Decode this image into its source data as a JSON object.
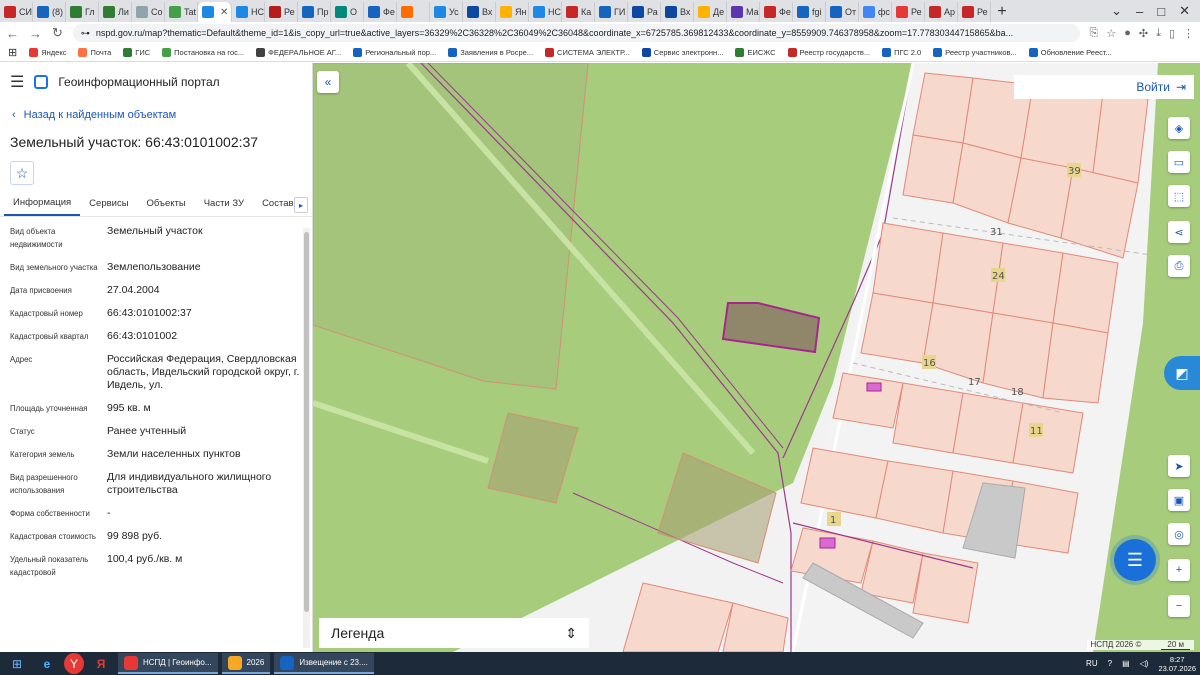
{
  "browser": {
    "tabs": [
      {
        "label": "СИ",
        "color": "#c62828"
      },
      {
        "label": "(8)",
        "color": "#1565c0"
      },
      {
        "label": "Гл",
        "color": "#2e7d32"
      },
      {
        "label": "Ли",
        "color": "#2e7d32"
      },
      {
        "label": "Со",
        "color": "#90a4ae"
      },
      {
        "label": "Tat",
        "color": "#43a047"
      },
      {
        "label": "",
        "color": "#1e88e5",
        "active": true
      },
      {
        "label": "НС",
        "color": "#1e88e5"
      },
      {
        "label": "Ре",
        "color": "#b71c1c"
      },
      {
        "label": "Пр",
        "color": "#1565c0"
      },
      {
        "label": "О",
        "color": "#00897b"
      },
      {
        "label": "Фе",
        "color": "#1565c0"
      },
      {
        "label": "",
        "color": "#ff6d00"
      },
      {
        "label": "Ус",
        "color": "#1e88e5"
      },
      {
        "label": "Вх",
        "color": "#0d47a1"
      },
      {
        "label": "Ян",
        "color": "#ffb300"
      },
      {
        "label": "НС",
        "color": "#1e88e5"
      },
      {
        "label": "Ка",
        "color": "#c62828"
      },
      {
        "label": "ГИ",
        "color": "#1565c0"
      },
      {
        "label": "Ра",
        "color": "#0d47a1"
      },
      {
        "label": "Вх",
        "color": "#0d47a1"
      },
      {
        "label": "Де",
        "color": "#ffb300"
      },
      {
        "label": "Ма",
        "color": "#5e35b1"
      },
      {
        "label": "Фе",
        "color": "#c62828"
      },
      {
        "label": "fgi",
        "color": "#1565c0"
      },
      {
        "label": "От",
        "color": "#1565c0"
      },
      {
        "label": "фс",
        "color": "#4285f4"
      },
      {
        "label": "Ре",
        "color": "#e53935"
      },
      {
        "label": "Ар",
        "color": "#c62828"
      },
      {
        "label": "Ре",
        "color": "#c62828"
      }
    ],
    "url": "nspd.gov.ru/map?thematic=Default&theme_id=1&is_copy_url=true&active_layers=36329%2C36328%2C36049%2C36048&coordinate_x=6725785.369812433&coordinate_y=8559909.746378958&zoom=17.77830344715865&ba...",
    "bookmarks": [
      {
        "label": "Яндекс",
        "color": "#e53935"
      },
      {
        "label": "Почта",
        "color": "#ff7043"
      },
      {
        "label": "ГИС",
        "color": "#2e7d32"
      },
      {
        "label": "Постановка на гос...",
        "color": "#43a047"
      },
      {
        "label": "ФЕДЕРАЛЬНОЕ АГ...",
        "color": "#424242"
      },
      {
        "label": "Региональный пор...",
        "color": "#1565c0"
      },
      {
        "label": "Заявления в Росре...",
        "color": "#1565c0"
      },
      {
        "label": "СИСТЕМА ЭЛЕКТР...",
        "color": "#c62828"
      },
      {
        "label": "Сервис электронн...",
        "color": "#0d47a1"
      },
      {
        "label": "ЕИСЖС",
        "color": "#2e7d32"
      },
      {
        "label": "Реестр государств...",
        "color": "#c62828"
      },
      {
        "label": "ПГС 2.0",
        "color": "#1565c0"
      },
      {
        "label": "Реестр участников...",
        "color": "#1565c0"
      },
      {
        "label": "Обновление Реест...",
        "color": "#1565c0"
      }
    ]
  },
  "portal": {
    "title": "Геоинформационный портал",
    "back_label": "Назад к найденным объектам",
    "object_title": "Земельный участок: 66:43:0101002:37",
    "tabs": [
      "Информация",
      "Сервисы",
      "Объекты",
      "Части ЗУ",
      "Состав"
    ],
    "props": [
      {
        "label": "Вид объекта недвижимости",
        "value": "Земельный участок"
      },
      {
        "label": "Вид земельного участка",
        "value": "Землепользование"
      },
      {
        "label": "Дата присвоения",
        "value": "27.04.2004"
      },
      {
        "label": "Кадастровый номер",
        "value": "66:43:0101002:37"
      },
      {
        "label": "Кадастровый квартал",
        "value": "66:43:0101002"
      },
      {
        "label": "Адрес",
        "value": "Российская Федерация, Свердловская область, Ивдельский городской округ, г. Ивдель, ул."
      },
      {
        "label": "Площадь уточненная",
        "value": "995 кв. м"
      },
      {
        "label": "Статус",
        "value": "Ранее учтенный"
      },
      {
        "label": "Категория земель",
        "value": "Земли населенных пунктов"
      },
      {
        "label": "Вид разрешенного использования",
        "value": "Для индивидуального жилищного строительства"
      },
      {
        "label": "Форма собственности",
        "value": "-"
      },
      {
        "label": "Кадастровая стоимость",
        "value": "99 898 руб."
      },
      {
        "label": "Удельный показатель кадастровой",
        "value": "100,4 руб./кв. м"
      }
    ]
  },
  "map": {
    "login_label": "Войти",
    "legend_label": "Легенда",
    "attribution": "НСПД 2026 ©",
    "scale_label": "20 м",
    "plot_numbers": [
      "39",
      "31",
      "24",
      "16",
      "17",
      "18",
      "11",
      "1"
    ]
  },
  "taskbar": {
    "windows": [
      {
        "label": "НСПД | Геоинфо...",
        "color": "#e53935"
      },
      {
        "label": "2026",
        "color": "#f9a825"
      },
      {
        "label": "Извещение с 23....",
        "color": "#1565c0"
      }
    ],
    "lang": "RU",
    "time": "8:27",
    "date": "23.07.2026"
  },
  "colors": {
    "accent": "#1a56b8",
    "map_green": "#a6cc7c",
    "parcel_pink": "#f7dcd3",
    "parcel_line": "#e08a7a",
    "selected_parcel": "#9c2a9c"
  }
}
